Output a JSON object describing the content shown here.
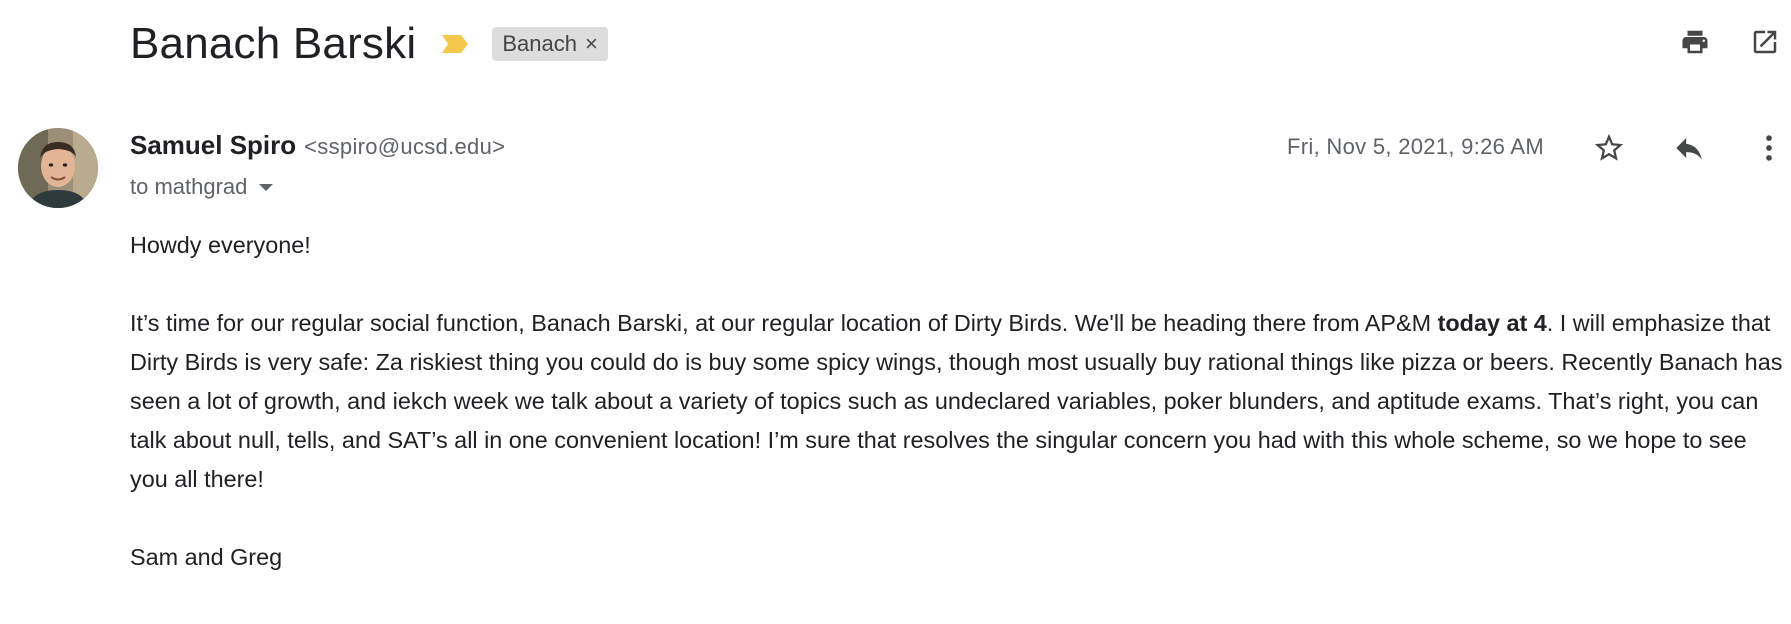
{
  "message": {
    "subject": "Banach Barski",
    "label": "Banach",
    "label_remove_glyph": "×",
    "sender": {
      "name": "Samuel Spiro",
      "email": "<sspiro@ucsd.edu>"
    },
    "recipients": "to mathgrad",
    "date": "Fri, Nov 5, 2021, 9:26 AM",
    "body": {
      "greeting": "Howdy everyone!",
      "paragraph_part1": "It’s time for our regular social function, Banach Barski, at our regular location of Dirty Birds.  We'll be heading there from AP&M ",
      "paragraph_bold": "today at 4",
      "paragraph_part2": ".  I will emphasize that Dirty Birds is very safe: Za riskiest thing you could do is buy some spicy wings, though most usually buy rational things like pizza or beers.  Recently Banach has seen a lot of growth, and iekch week we talk about a variety of topics such as undeclared variables, poker blunders, and aptitude exams.  That’s right, you can talk about null, tells, and SAT’s all in one convenient location!  I’m sure that resolves the singular concern you had with this whole scheme, so we hope to see you all there!",
      "signature": "Sam and Greg"
    }
  },
  "icons": {
    "importance": "importance-marker-icon",
    "print": "print-icon",
    "open_new_window": "open-in-new-window-icon",
    "star": "star-icon",
    "reply": "reply-icon",
    "more": "more-vertical-icon",
    "caret": "caret-down-icon"
  },
  "colors": {
    "importance_marker": "#f2c94c",
    "label_chip_bg": "#dddddd",
    "secondary_text": "#5f6368",
    "primary_text": "#202124"
  }
}
